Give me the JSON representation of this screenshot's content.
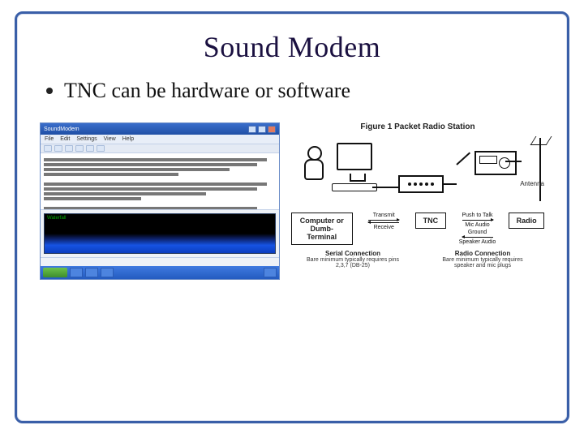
{
  "title": "Sound Modem",
  "bullet": "TNC can be hardware or software",
  "left_app": {
    "window_title": "SoundModem",
    "menus": [
      "File",
      "Edit",
      "Settings",
      "View",
      "Help"
    ],
    "spectrum_label": "Waterfall"
  },
  "diagram": {
    "figure_title": "Figure 1  Packet Radio Station",
    "antenna_label": "Antenna",
    "blocks": {
      "computer": "Computer or\nDumb-Terminal",
      "tnc": "TNC",
      "radio": "Radio"
    },
    "arrows_left": {
      "top": "Transmit",
      "bottom": "Receive"
    },
    "arrows_right": {
      "top": "Push to Talk",
      "mid": "Mic Audio",
      "ground": "Ground",
      "bottom": "Speaker Audio"
    },
    "under": {
      "serial": {
        "title": "Serial Connection",
        "sub": "Bare minimum typically requires pins 2,3,7 (DB-25)"
      },
      "radio": {
        "title": "Radio Connection",
        "sub": "Bare minimum typically requires speaker and mic plugs"
      }
    }
  }
}
